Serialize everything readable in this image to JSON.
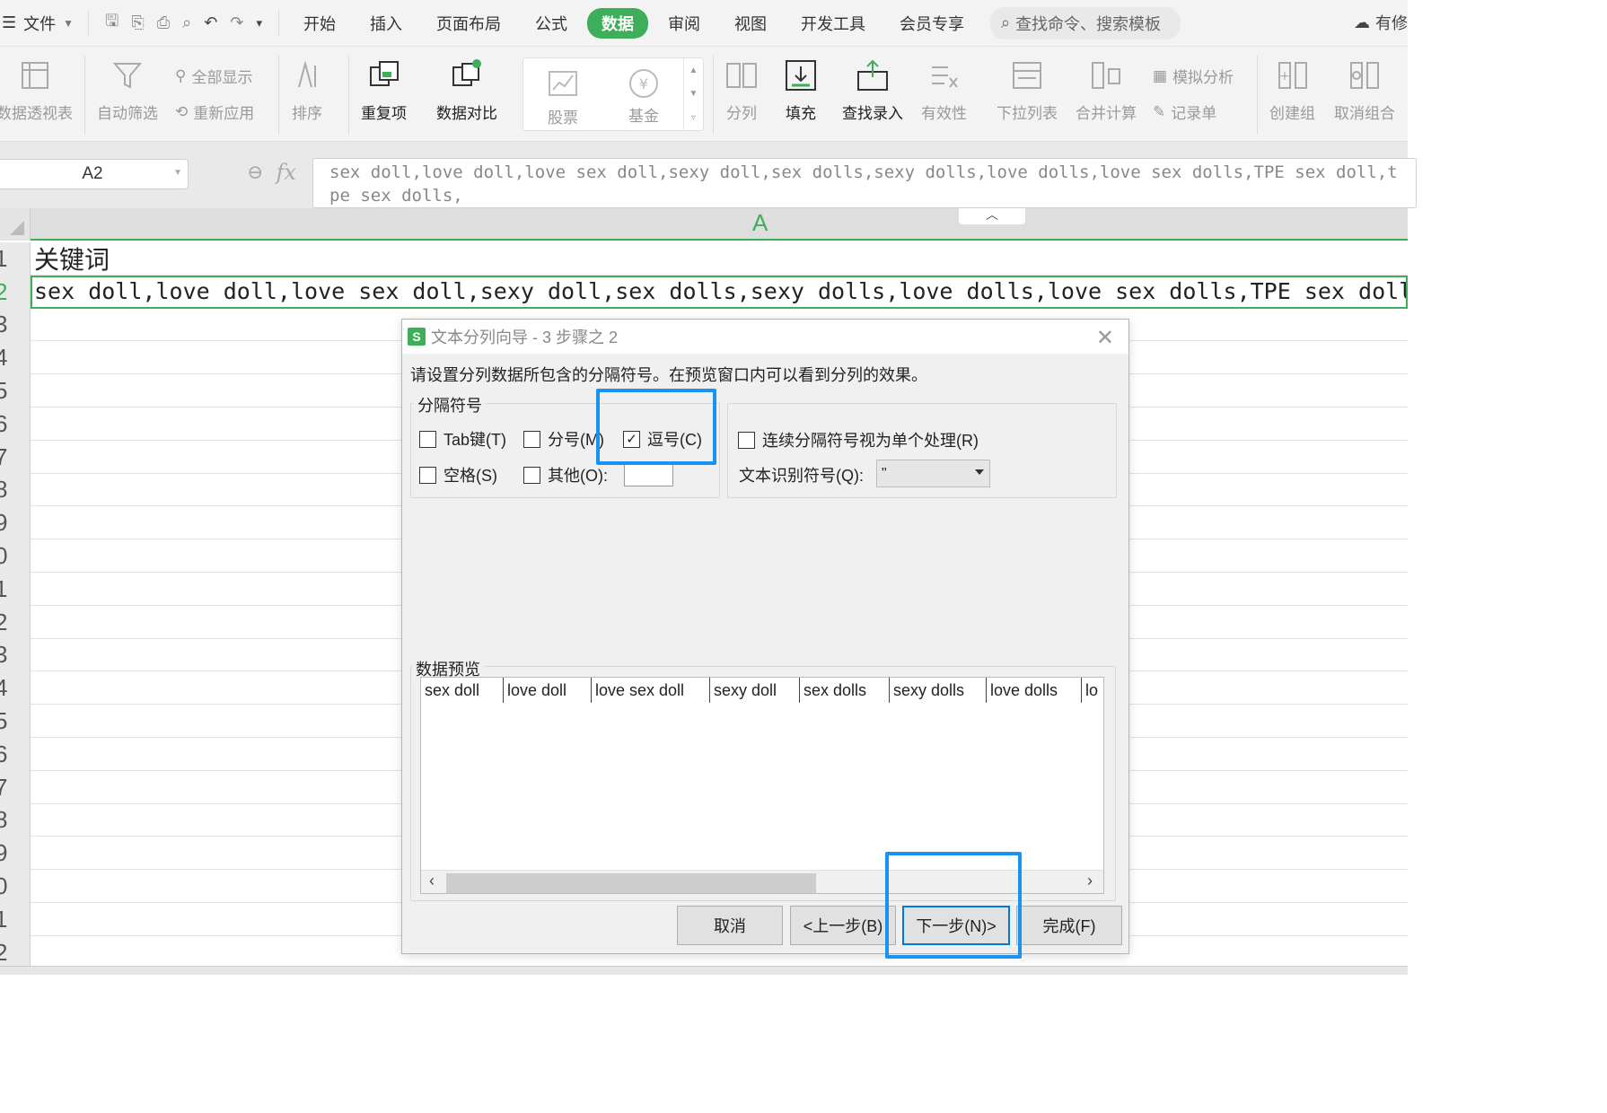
{
  "menubar": {
    "file_label": "文件",
    "tabs": [
      "开始",
      "插入",
      "页面布局",
      "公式",
      "数据",
      "审阅",
      "视图",
      "开发工具",
      "会员专享"
    ],
    "active_tab": "数据",
    "search_placeholder": "查找命令、搜索模板",
    "right_label": "有修"
  },
  "ribbon": {
    "pivot": "数据透视表",
    "autofilter": "自动筛选",
    "show_all": "全部显示",
    "reapply": "重新应用",
    "sort": "排序",
    "duplicates": "重复项",
    "compare": "数据对比",
    "stock": "股票",
    "fund": "基金",
    "split": "分列",
    "fill": "填充",
    "find_entry": "查找录入",
    "validity": "有效性",
    "dropdown_list": "下拉列表",
    "consolidate": "合并计算",
    "simulate": "模拟分析",
    "record_form": "记录单",
    "group": "创建组",
    "ungroup": "取消组合"
  },
  "formula_bar": {
    "name_box": "A2",
    "fx": "fx",
    "content": "sex doll,love doll,love sex doll,sexy doll,sex dolls,sexy dolls,love dolls,love sex dolls,TPE sex doll,tpe sex dolls,"
  },
  "sheet": {
    "column_header": "A",
    "row_numbers": [
      "1",
      "2",
      "3",
      "4",
      "5",
      "6",
      "7",
      "8",
      "9",
      "0",
      "1",
      "2",
      "3",
      "4",
      "5",
      "6",
      "7",
      "8",
      "9",
      "0",
      "1",
      "2"
    ],
    "a1": "关键词",
    "a2": "sex doll,love doll,love sex doll,sexy doll,sex dolls,sexy dolls,love dolls,love sex dolls,TPE sex doll,"
  },
  "dialog": {
    "title": "文本分列向导 - 3 步骤之 2",
    "description": "请设置分列数据所包含的分隔符号。在预览窗口内可以看到分列的效果。",
    "delimiters_legend": "分隔符号",
    "tab_label": "Tab键(T)",
    "semicolon_label": "分号(M)",
    "comma_label": "逗号(C)",
    "space_label": "空格(S)",
    "other_label": "其他(O):",
    "consecutive_label": "连续分隔符号视为单个处理(R)",
    "qualifier_label": "文本识别符号(Q):",
    "qualifier_value": "\"",
    "preview_legend": "数据预览",
    "preview_cells": [
      "sex doll",
      "love doll",
      "love sex doll",
      "sexy doll",
      "sex dolls",
      "sexy dolls",
      "love dolls",
      "lo"
    ],
    "checked": {
      "tab": false,
      "semicolon": false,
      "comma": true,
      "space": false,
      "other": false,
      "consecutive": false
    },
    "buttons": {
      "cancel": "取消",
      "back": "<上一步(B)",
      "next": "下一步(N)>",
      "finish": "完成(F)"
    }
  },
  "colors": {
    "accent": "#3fae5a",
    "highlight": "#1a93f0"
  }
}
